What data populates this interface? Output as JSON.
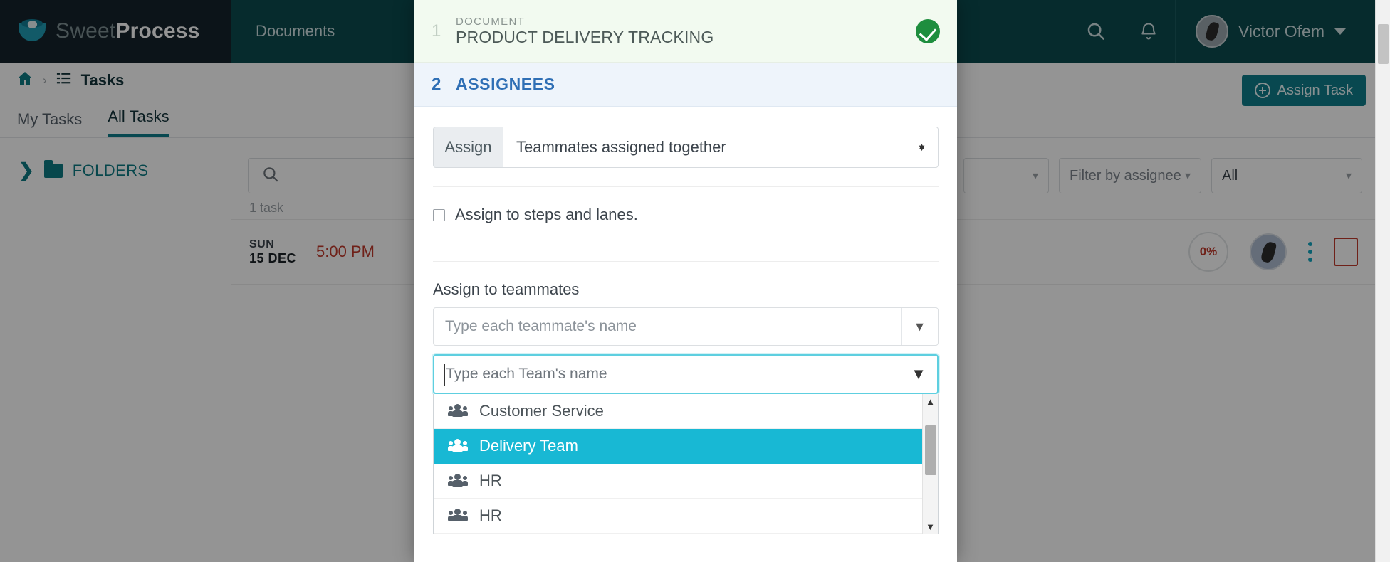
{
  "topnav": {
    "brand_sweet": "Sweet",
    "brand_process": "Process",
    "items": [
      {
        "label": "Documents"
      }
    ],
    "search_icon": "search-icon",
    "bell_icon": "bell-icon",
    "user_name": "Victor Ofem"
  },
  "breadcrumb": {
    "home_icon": "home-icon",
    "separator": "›",
    "list_icon": "task-list-icon",
    "label": "Tasks"
  },
  "header": {
    "assign_task_label": "Assign Task"
  },
  "tabs": [
    {
      "label": "My Tasks",
      "active": false
    },
    {
      "label": "All Tasks",
      "active": true
    }
  ],
  "sidebar": {
    "folders_label": "FOLDERS",
    "expand_icon": "chevron-right-icon",
    "folder_icon": "folder-icon"
  },
  "toolbar": {
    "search_placeholder": "",
    "search_icon": "search-icon",
    "filters": [
      {
        "name": "filter-1",
        "value": ""
      },
      {
        "name": "filter-by-assignee",
        "value": "Filter by assignee"
      },
      {
        "name": "filter-status",
        "value": "All"
      }
    ]
  },
  "task_list": {
    "count_label": "1 task",
    "rows": [
      {
        "dow": "SUN",
        "day": "15 DEC",
        "time": "5:00 PM",
        "progress": "0%"
      }
    ]
  },
  "modal": {
    "step1": {
      "number": "1",
      "kicker": "DOCUMENT",
      "title": "PRODUCT DELIVERY TRACKING",
      "status_icon": "check-circle-icon"
    },
    "step2": {
      "number": "2",
      "label": "ASSIGNEES"
    },
    "assign": {
      "prefix_label": "Assign",
      "selected": "Teammates assigned together"
    },
    "steps_lanes": {
      "checked": false,
      "label": "Assign to steps and lanes."
    },
    "teammates": {
      "label": "Assign to teammates",
      "placeholder": "Type each teammate's name"
    },
    "teams": {
      "placeholder": "Type each Team's name",
      "options": [
        {
          "label": "Customer Service",
          "selected": false
        },
        {
          "label": "Delivery Team",
          "selected": true
        },
        {
          "label": "HR",
          "selected": false
        },
        {
          "label": "HR",
          "selected": false
        }
      ]
    }
  },
  "colors": {
    "brand_dark": "#15242b",
    "nav_teal": "#0c4b4f",
    "accent_teal": "#0e7d8a",
    "highlight_cyan": "#18b8d4",
    "success_green": "#1e8e3e",
    "danger_red": "#c0392b",
    "step2_blue": "#2f6fb5"
  }
}
